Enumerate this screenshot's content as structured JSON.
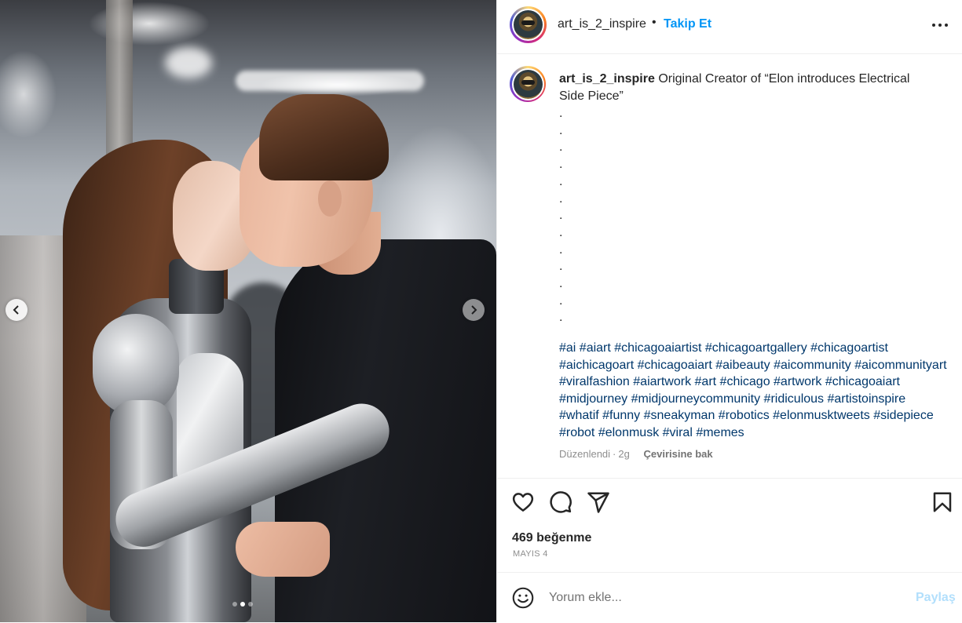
{
  "post": {
    "username": "art_is_2_inspire",
    "follow_label": "Takip Et",
    "separator": "•",
    "caption": {
      "username": "art_is_2_inspire",
      "text": "Original Creator of “Elon introduces Electrical Side Piece”",
      "dots": [
        ".",
        ".",
        ".",
        ".",
        ".",
        ".",
        ".",
        ".",
        ".",
        ".",
        ".",
        ".",
        "."
      ],
      "hashtags": "#ai #aiart #chicagoaiartist #chicagoartgallery #chicagoartist #aichicagoart #chicagoaiart #aibeauty #aicommunity #aicommunityart #viralfashion #aiartwork #art #chicago #artwork #chicagoaiart #midjourney #midjourneycommunity #ridiculous #artistoinspire #whatif #funny #sneakyman #robotics #elonmusktweets #sidepiece #robot #elonmusk #viral #memes",
      "edited_label": "Düzenlendi",
      "age": "2g",
      "translate_label": "Çevirisine bak"
    },
    "likes_text": "469 beğenme",
    "date_text": "MAYIS 4"
  },
  "comment": {
    "placeholder": "Yorum ekle...",
    "post_label": "Paylaş"
  },
  "carousel": {
    "total_slides": 3,
    "current_slide": 2
  },
  "colors": {
    "link_blue": "#0095f6",
    "hashtag_blue": "#00376b",
    "muted_gray": "#8e8e8e",
    "disabled_post": "#b2dffc"
  }
}
